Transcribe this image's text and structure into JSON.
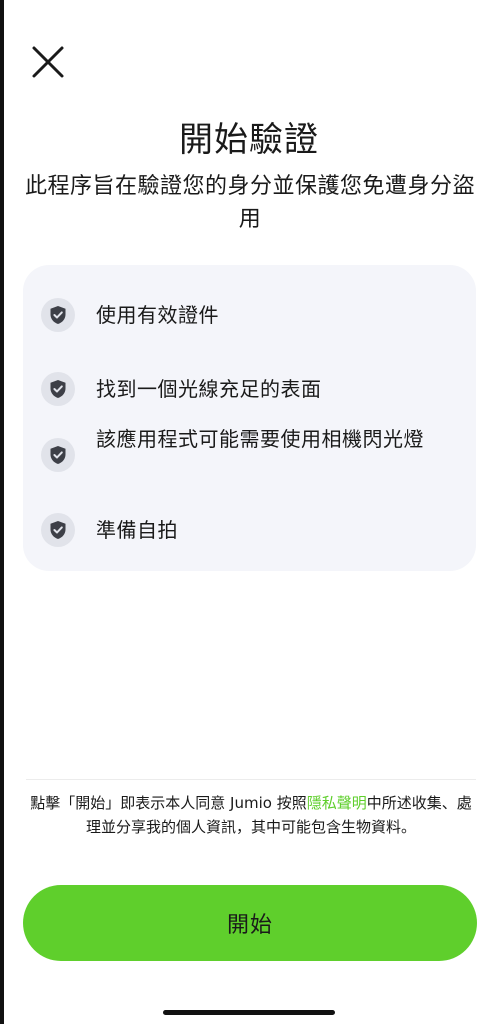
{
  "header": {
    "close_icon": "close-icon",
    "title": "開始驗證",
    "subtitle": "此程序旨在驗證您的身分並保護您免遭身分盜用"
  },
  "requirements": {
    "icon": "shield-check-icon",
    "items": [
      {
        "label": "使用有效證件"
      },
      {
        "label": "找到一個光線充足的表面"
      },
      {
        "label": "該應用程式可能需要使用相機閃光燈"
      },
      {
        "label": "準備自拍"
      }
    ]
  },
  "consent": {
    "prefix": "點擊「開始」即表示本人同意 Jumio 按照",
    "link": "隱私聲明",
    "suffix": "中所述收集、處理並分享我的個人資訊，其中可能包含生物資料。"
  },
  "footer": {
    "start_label": "開始"
  },
  "colors": {
    "accent": "#5fcf2c",
    "card_bg": "#f4f5fa",
    "icon_bg": "#e1e3ea",
    "icon_fg": "#3d3f47",
    "text": "#1a1a1a"
  }
}
